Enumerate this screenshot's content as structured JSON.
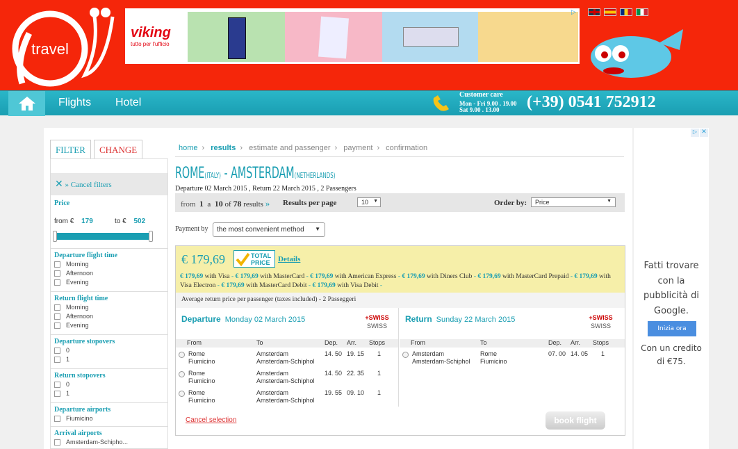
{
  "brand": {
    "logo_text": "travel"
  },
  "banner": {
    "brand": "viking",
    "tagline": "tutto per l'ufficio",
    "ad_icon": "adchoices-icon"
  },
  "flags": [
    "uk-flag",
    "es-flag",
    "ro-flag",
    "it-flag"
  ],
  "nav": {
    "home_icon": "home-icon",
    "items": [
      "Flights",
      "Hotel"
    ],
    "care_label": "Customer care",
    "hours": [
      "Mon - Fri 9.00 . 19.00",
      "Sat 9.00 . 13.00"
    ],
    "phone": "(+39) 0541 752912"
  },
  "filters": {
    "tab_filter": "FILTER",
    "tab_change": "CHANGE",
    "cancel": "» Cancel filters",
    "price_label": "Price",
    "price_from_label": "from €",
    "price_from": "179",
    "price_to_label": "to €",
    "price_to": "502",
    "groups": [
      {
        "title": "Departure flight time",
        "options": [
          "Morning",
          "Afternoon",
          "Evening"
        ]
      },
      {
        "title": "Return flight time",
        "options": [
          "Morning",
          "Afternoon",
          "Evening"
        ]
      },
      {
        "title": "Departure stopovers",
        "options": [
          "0",
          "1"
        ]
      },
      {
        "title": "Return stopovers",
        "options": [
          "0",
          "1"
        ]
      },
      {
        "title": "Departure airports",
        "options": [
          "Fiumicino"
        ]
      },
      {
        "title": "Arrival airports",
        "options": [
          "Amsterdam-Schipho..."
        ]
      }
    ]
  },
  "breadcrumb": [
    "home",
    "results",
    "estimate and passenger",
    "payment",
    "confirmation"
  ],
  "route": {
    "from": "ROME",
    "from_country": "(ITALY)",
    "sep": " - ",
    "to": "AMSTERDAM",
    "to_country": "(NETHERLANDS)",
    "summary": "Departure 02 March 2015 , Return 22 March 2015 , 2 Passengers"
  },
  "results": {
    "from_label": "from",
    "from": "1",
    "a": "a",
    "to": "10",
    "of": "of",
    "total": "78",
    "results_label": "results",
    "arrow": "»",
    "per_page_label": "Results per page",
    "per_page": "10",
    "order_label": "Order by:",
    "order": "Price"
  },
  "payment": {
    "label": "Payment by",
    "value": "the most convenient method"
  },
  "offer": {
    "price": "€ 179,69",
    "badge": [
      "TOTAL",
      "PRICE"
    ],
    "details": "Details",
    "methods": [
      {
        "price": "€ 179,69",
        "method": "with Visa"
      },
      {
        "price": "€ 179,69",
        "method": "with MasterCard"
      },
      {
        "price": "€ 179,69",
        "method": "with American Express"
      },
      {
        "price": "€ 179,69",
        "method": "with Diners Club"
      },
      {
        "price": "€ 179,69",
        "method": "with MasterCard Prepaid"
      },
      {
        "price": "€ 179,69",
        "method": "with Visa Electron"
      },
      {
        "price": "€ 179,69",
        "method": "with MasterCard Debit"
      },
      {
        "price": "€ 179,69",
        "method": "with Visa Debit"
      }
    ],
    "avg": "Average return price per passenger (taxes included) - 2 Passeggeri",
    "columns": [
      "From",
      "To",
      "Dep.",
      "Arr.",
      "Stops"
    ],
    "departure": {
      "label": "Departure",
      "date": "Monday 02 March 2015",
      "airline": "SWISS",
      "airline_logo": "+SWISS",
      "rows": [
        {
          "from": [
            "Rome",
            "Fiumicino"
          ],
          "to": [
            "Amsterdam",
            "Amsterdam-Schiphol"
          ],
          "dep": "14. 50",
          "arr": "19. 15",
          "stops": "1"
        },
        {
          "from": [
            "Rome",
            "Fiumicino"
          ],
          "to": [
            "Amsterdam",
            "Amsterdam-Schiphol"
          ],
          "dep": "14. 50",
          "arr": "22. 35",
          "stops": "1"
        },
        {
          "from": [
            "Rome",
            "Fiumicino"
          ],
          "to": [
            "Amsterdam",
            "Amsterdam-Schiphol"
          ],
          "dep": "19. 55",
          "arr": "09. 10",
          "stops": "1"
        }
      ]
    },
    "return": {
      "label": "Return",
      "date": "Sunday 22 March 2015",
      "airline": "SWISS",
      "airline_logo": "+SWISS",
      "rows": [
        {
          "from": [
            "Amsterdam",
            "Amsterdam-Schiphol"
          ],
          "to": [
            "Rome",
            "Fiumicino"
          ],
          "dep": "07. 00",
          "arr": "14. 05",
          "stops": "1"
        }
      ]
    },
    "cancel": "Cancel selection",
    "book": "book flight"
  },
  "ad": {
    "text": "Fatti trovare con la pubblicità di Google.",
    "button": "Inizia ora",
    "footer": "Con un credito di €75."
  },
  "colors": {
    "header": "#f5260a",
    "accent": "#1a9eb2",
    "price_band": "#f6efa9"
  }
}
